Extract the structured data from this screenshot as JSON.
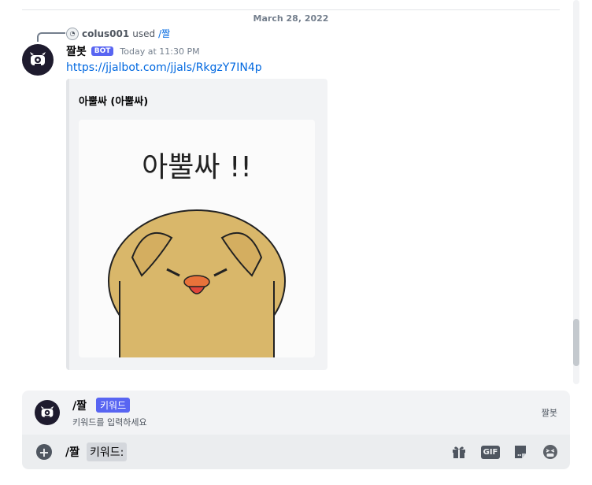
{
  "divider": {
    "date": "March 28, 2022"
  },
  "reply": {
    "user": "colus001",
    "used": "used",
    "command": "/짤"
  },
  "message": {
    "author": "짤봇",
    "tag": "BOT",
    "timestamp": "Today at 11:30 PM",
    "link": "https://jjalbot.com/jjals/RkgzY7IN4p",
    "embed": {
      "title": "아뿔싸 (아뿔싸)",
      "image_text": "아뿔싸 !!"
    }
  },
  "autocomplete": {
    "command": "/짤",
    "option": "키워드",
    "description": "키워드를 입력하세요",
    "app": "짤봇"
  },
  "input": {
    "command": "/짤",
    "field": "키워드:"
  },
  "icons": {
    "plus": "plus-circle-icon",
    "gift": "gift-icon",
    "gif": "GIF",
    "sticker": "sticker-icon",
    "emoji": "emoji-icon"
  }
}
